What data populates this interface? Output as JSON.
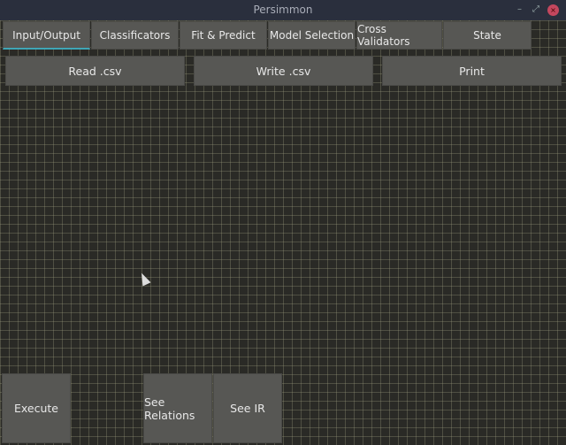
{
  "window": {
    "title": "Persimmon",
    "minimize": "–",
    "maximize": "⤢",
    "close": "×"
  },
  "tabs": [
    {
      "label": "Input/Output",
      "active": true
    },
    {
      "label": "Classificators"
    },
    {
      "label": "Fit & Predict"
    },
    {
      "label": "Model Selection"
    },
    {
      "label": "Cross Validators"
    },
    {
      "label": "State"
    }
  ],
  "toolbar": {
    "read": "Read .csv",
    "write": "Write .csv",
    "print": "Print"
  },
  "bottom": {
    "execute": "Execute",
    "relations": "See Relations",
    "ir": "See IR"
  },
  "colors": {
    "accent": "#3fa6b6",
    "button": "#575754",
    "background": "#2a2a26"
  }
}
